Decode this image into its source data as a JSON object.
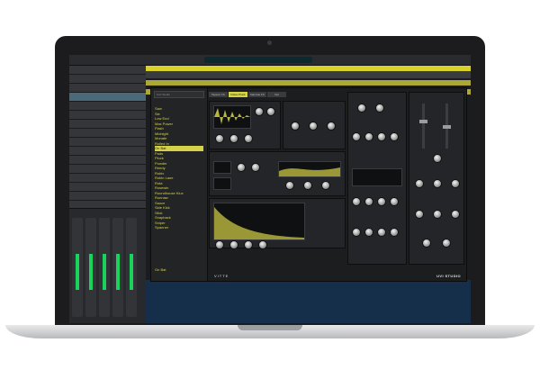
{
  "plugin": {
    "brand": "UVI STUDIO",
    "logo": "VITTE",
    "search_placeholder": "Sort Studio",
    "tabs": [
      "Taperer FS",
      "Yellow Pluck",
      "Saturate FS",
      "Del"
    ],
    "active_tab": "Yellow Pluck",
    "browser_items": [
      "Saw",
      "Sie",
      "Low End",
      "Max Power",
      "Flash",
      "Midnight",
      "Monate",
      "Rolled In",
      "On Bat",
      "Pads",
      "Pluck",
      "Powder",
      "Reedy",
      "Rubix",
      "Robin Lane",
      "Rota",
      "Rosewin",
      "Roundhouse Klux",
      "Runnaw",
      "Sauce",
      "Side Kick",
      "Slick",
      "Snapback",
      "Sniper",
      "Spanner"
    ],
    "selected_item": "On Bat",
    "current_preset": "On Bat"
  },
  "colors": {
    "accent": "#d6d247",
    "background": "#1c1d1f",
    "panel": "#242528"
  }
}
